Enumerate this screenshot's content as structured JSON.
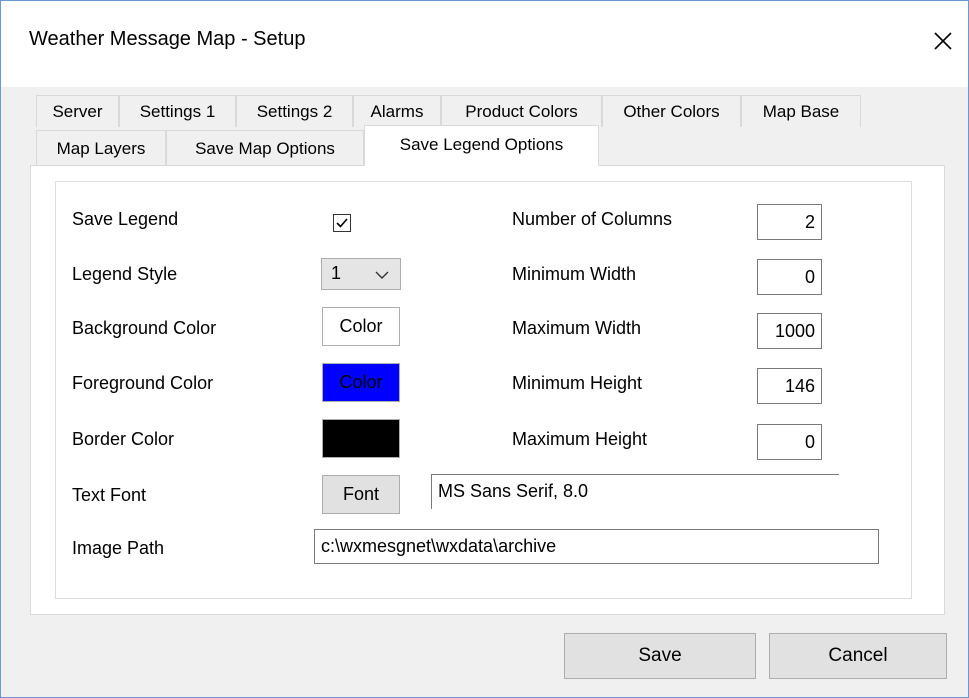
{
  "window": {
    "title": "Weather Message Map - Setup",
    "close_glyph": "✕"
  },
  "tabs": {
    "row1": [
      "Server",
      "Settings 1",
      "Settings 2",
      "Alarms",
      "Product Colors",
      "Other Colors",
      "Map Base"
    ],
    "row2": [
      "Map Layers",
      "Save Map Options",
      "Save Legend Options"
    ],
    "active": "Save Legend Options"
  },
  "form": {
    "save_legend": {
      "label": "Save Legend",
      "checked": true
    },
    "legend_style": {
      "label": "Legend Style",
      "value": "1"
    },
    "background_color": {
      "label": "Background Color",
      "button": "Color",
      "color": "#ffffff"
    },
    "foreground_color": {
      "label": "Foreground Color",
      "button": "Color",
      "color": "#0000ff"
    },
    "border_color": {
      "label": "Border Color",
      "color": "#000000"
    },
    "text_font": {
      "label": "Text Font",
      "button": "Font",
      "value": "MS Sans Serif, 8.0"
    },
    "image_path": {
      "label": "Image Path",
      "value": "c:\\wxmesgnet\\wxdata\\archive"
    },
    "number_of_columns": {
      "label": "Number of Columns",
      "value": "2"
    },
    "minimum_width": {
      "label": "Minimum Width",
      "value": "0"
    },
    "maximum_width": {
      "label": "Maximum Width",
      "value": "1000"
    },
    "minimum_height": {
      "label": "Minimum Height",
      "value": "146"
    },
    "maximum_height": {
      "label": "Maximum Height",
      "value": "0"
    }
  },
  "footer": {
    "save": "Save",
    "cancel": "Cancel"
  },
  "colors": {
    "window_border": "#6d97d4",
    "foreground_swatch": "#0000ff",
    "border_swatch": "#000000"
  }
}
